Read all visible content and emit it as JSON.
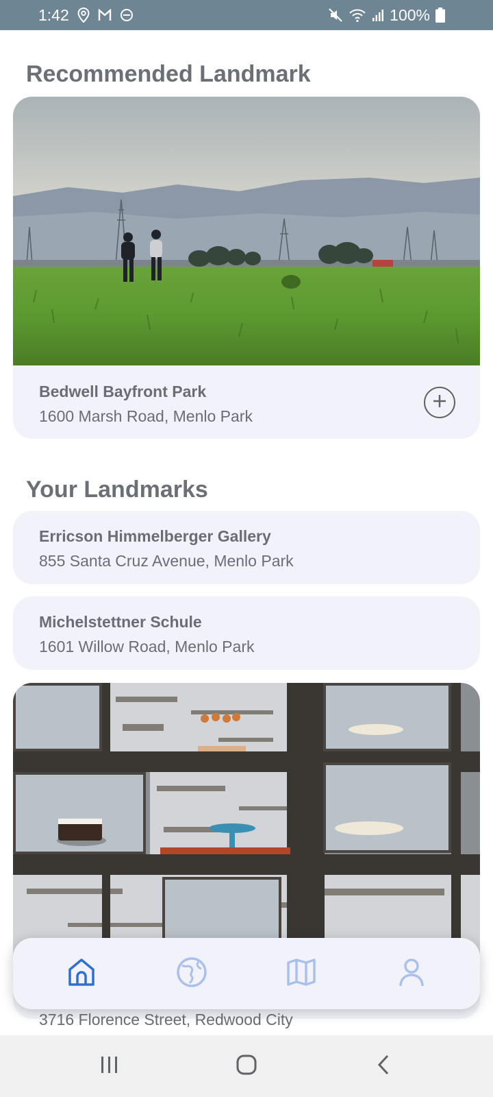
{
  "status_bar": {
    "time": "1:42",
    "battery": "100%",
    "left_icons": [
      "location-icon",
      "gmail-icon",
      "do-not-disturb-icon"
    ],
    "right_icons": [
      "mute-icon",
      "wifi-icon",
      "signal-icon",
      "battery-icon"
    ]
  },
  "recommended": {
    "title": "Recommended Landmark",
    "name": "Bedwell Bayfront Park",
    "address": "1600 Marsh Road, Menlo Park"
  },
  "your_landmarks": {
    "title": "Your Landmarks",
    "items": [
      {
        "name": "Erricson Himmelberger Gallery",
        "address": "855 Santa Cruz Avenue, Menlo Park"
      },
      {
        "name": "Michelstettner Schule",
        "address": "1601 Willow Road, Menlo Park"
      },
      {
        "address": "3716 Florence Street, Redwood City"
      }
    ]
  },
  "tab_bar": {
    "tabs": [
      "home-icon",
      "globe-icon",
      "map-icon",
      "profile-icon"
    ],
    "active_color": "#2f6fd1",
    "inactive_color": "#a9c1ea"
  },
  "nav_bar": {
    "buttons": [
      "recents-icon",
      "home-circle-icon",
      "back-icon"
    ]
  },
  "colors": {
    "status_bar": "#6e8594",
    "card": "#f2f3fa",
    "text": "#6a6e74"
  }
}
